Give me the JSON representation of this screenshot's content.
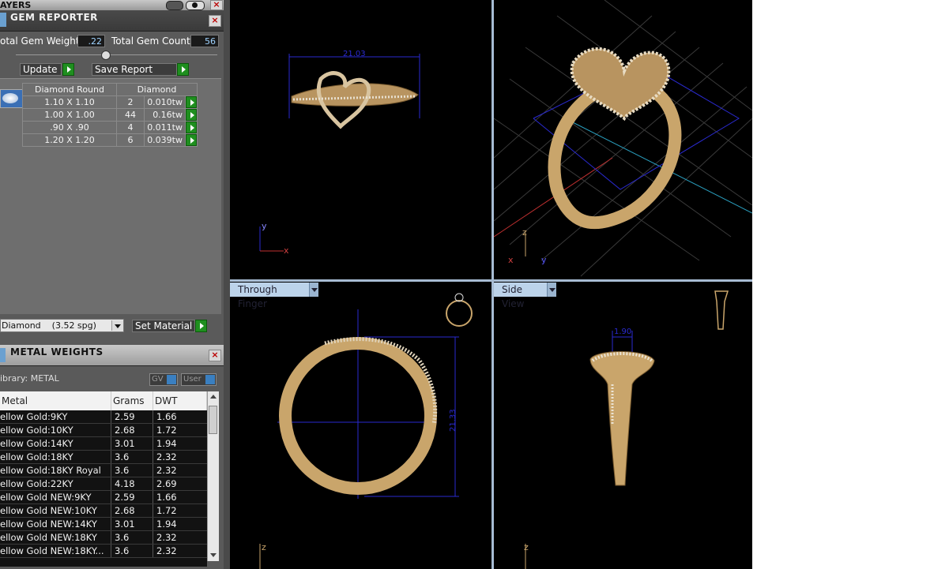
{
  "layers_tab": {
    "title": "AYERS"
  },
  "gem_reporter": {
    "title": "GEM REPORTER",
    "total_weight_label": "otal Gem Weight",
    "total_weight_value": ".22",
    "total_count_label": "Total Gem Count",
    "total_count_value": "56",
    "update_label": "Update",
    "save_report_label": "Save Report",
    "table_headers": [
      "Diamond Round",
      "Diamond"
    ],
    "rows": [
      {
        "size": "1.10 X 1.10",
        "count": "2",
        "weight": "0.010tw"
      },
      {
        "size": "1.00 X 1.00",
        "count": "44",
        "weight": "0.16tw"
      },
      {
        "size": ".90 X .90",
        "count": "4",
        "weight": "0.011tw"
      },
      {
        "size": "1.20 X 1.20",
        "count": "6",
        "weight": "0.039tw"
      }
    ],
    "material_value": "Diamond    (3.52 spg)",
    "set_material_label": "Set Material"
  },
  "metal_weights": {
    "title": "METAL WEIGHTS",
    "library_label": "ibrary: METAL",
    "gv_label": "GV",
    "user_label": "User",
    "columns": [
      "Metal",
      "Grams",
      "DWT"
    ],
    "rows": [
      {
        "metal": "ellow Gold:9KY",
        "grams": "2.59",
        "dwt": "1.66"
      },
      {
        "metal": "ellow Gold:10KY",
        "grams": "2.68",
        "dwt": "1.72"
      },
      {
        "metal": "ellow Gold:14KY",
        "grams": "3.01",
        "dwt": "1.94"
      },
      {
        "metal": "ellow Gold:18KY",
        "grams": "3.6",
        "dwt": "2.32"
      },
      {
        "metal": "ellow Gold:18KY Royal",
        "grams": "3.6",
        "dwt": "2.32"
      },
      {
        "metal": "ellow Gold:22KY",
        "grams": "4.18",
        "dwt": "2.69"
      },
      {
        "metal": "ellow Gold NEW:9KY",
        "grams": "2.59",
        "dwt": "1.66"
      },
      {
        "metal": "ellow Gold NEW:10KY",
        "grams": "2.68",
        "dwt": "1.72"
      },
      {
        "metal": "ellow Gold NEW:14KY",
        "grams": "3.01",
        "dwt": "1.94"
      },
      {
        "metal": "ellow Gold NEW:18KY",
        "grams": "3.6",
        "dwt": "2.32"
      },
      {
        "metal": "ellow Gold NEW:18KY...",
        "grams": "3.6",
        "dwt": "2.32"
      }
    ]
  },
  "viewports": {
    "top": {
      "dimension": "21.03",
      "axis_y": "y",
      "axis_x": "x"
    },
    "perspective": {
      "axis_z": "z",
      "axis_x": "x",
      "axis_y": "y"
    },
    "through_finger": {
      "label": "Through Finger",
      "dimension": "21.33",
      "axis_z": "z"
    },
    "side": {
      "label": "Side View",
      "dimension": "1.90",
      "axis_z": "z"
    }
  },
  "colors": {
    "gold": "#c9a56b",
    "accent_green": "#1f8f1f",
    "viewport_label_bg": "#bcd3ea",
    "dimension_blue": "#2a2ad0"
  }
}
